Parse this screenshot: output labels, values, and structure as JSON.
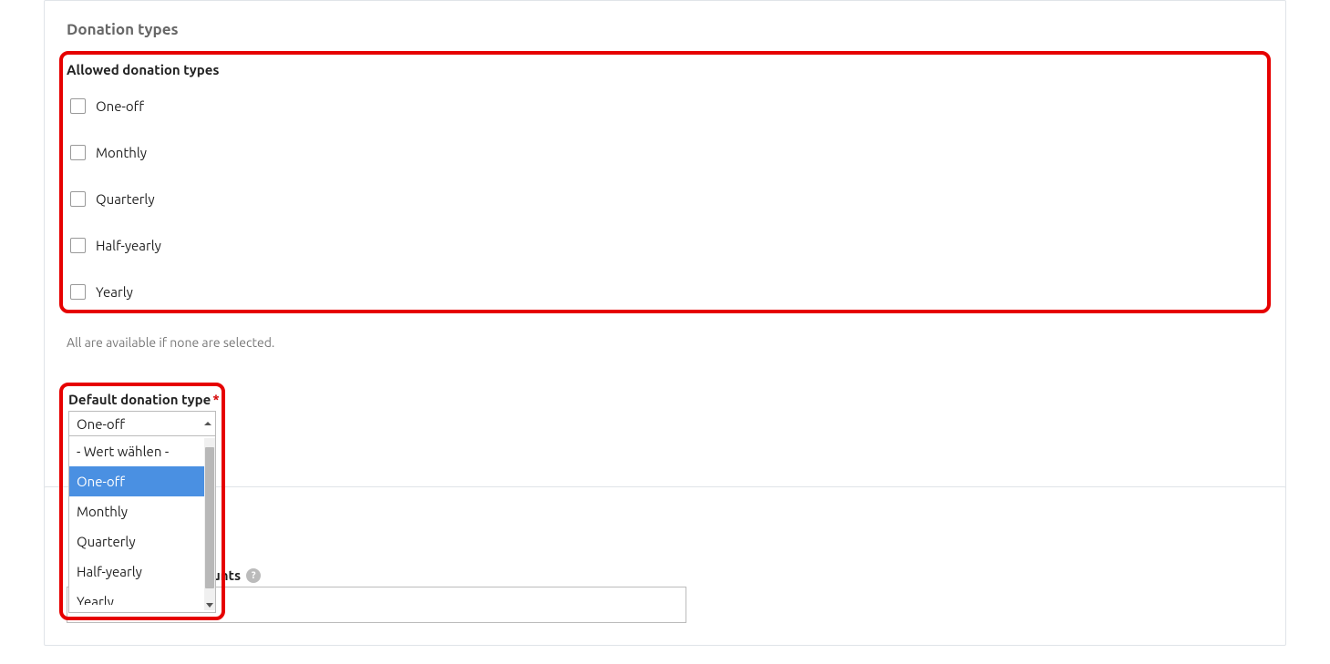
{
  "panel1": {
    "title": "Donation types",
    "allowed_label": "Allowed donation types",
    "checkboxes": {
      "one_off": "One-off",
      "monthly": "Monthly",
      "quarterly": "Quarterly",
      "half_yearly": "Half-yearly",
      "yearly": "Yearly"
    },
    "help_text": "All are available if none are selected.",
    "default_label": "Default donation type",
    "required_marker": "*",
    "select_value": "One-off",
    "dropdown": {
      "placeholder": "- Wert wählen -",
      "one_off": "One-off",
      "monthly": "Monthly",
      "quarterly": "Quarterly",
      "half_yearly": "Half-yearly",
      "yearly": "Yearly"
    }
  },
  "panel2": {
    "amounts_label_partial": "unts",
    "amounts_value": ""
  }
}
